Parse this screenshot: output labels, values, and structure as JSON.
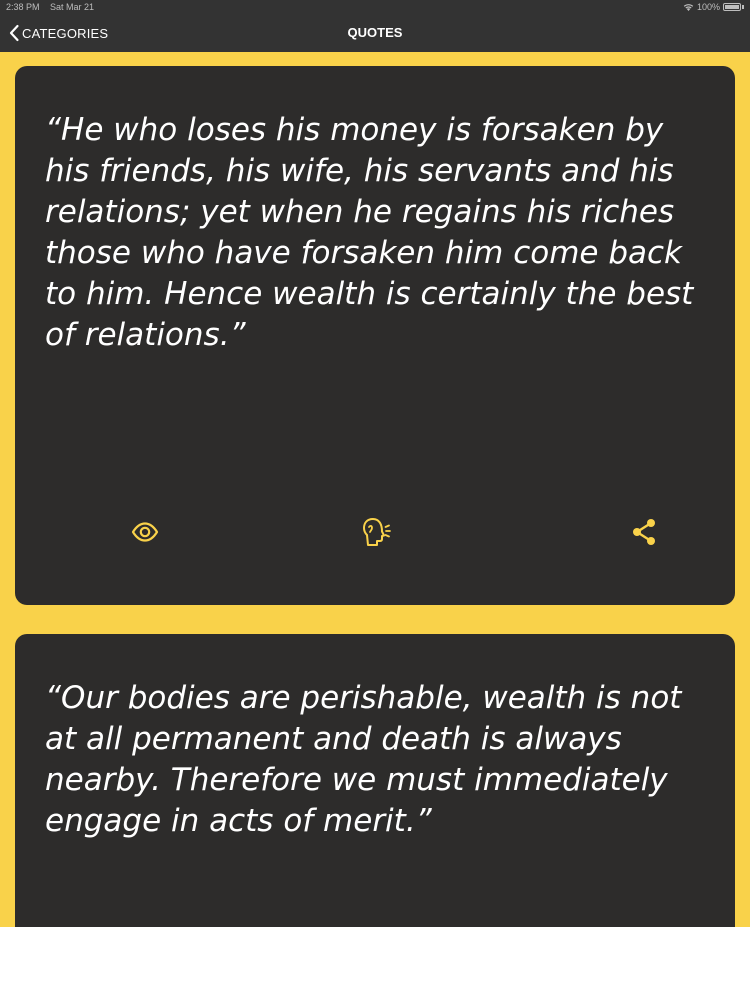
{
  "status_bar": {
    "time": "2:38 PM",
    "date": "Sat Mar 21",
    "wifi_icon": "wifi-icon",
    "battery": "100%"
  },
  "nav": {
    "back_label": "CATEGORIES",
    "title": "QUOTES"
  },
  "colors": {
    "accent": "#f9d24a",
    "card": "#2d2c2b",
    "bar": "#333333"
  },
  "quotes": [
    {
      "text": "“He who loses his money is forsaken by his friends, his wife, his servants and his relations; yet when he regains his riches those who have forsaken him come back to him. Hence wealth is certainly the best of relations.”",
      "actions": [
        "eye-icon",
        "speak-head-icon",
        "share-icon"
      ]
    },
    {
      "text": "“Our bodies are perishable, wealth is not at all permanent and death is always nearby. Therefore we must immediately engage in acts of merit.”"
    }
  ]
}
